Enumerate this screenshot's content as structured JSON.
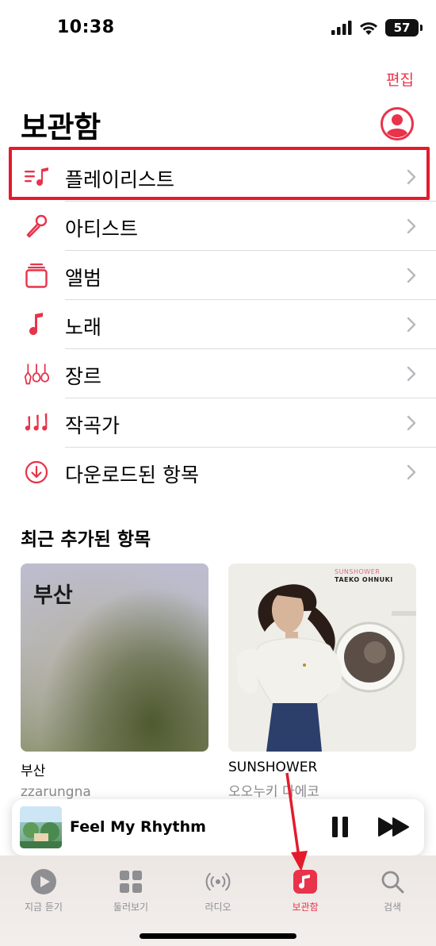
{
  "status": {
    "time": "10:38",
    "battery": "57"
  },
  "header": {
    "edit": "편집",
    "title": "보관함"
  },
  "menu": [
    {
      "label": "플레이리스트",
      "icon": "playlist-icon"
    },
    {
      "label": "아티스트",
      "icon": "microphone-icon"
    },
    {
      "label": "앨범",
      "icon": "album-stack-icon"
    },
    {
      "label": "노래",
      "icon": "music-note-icon"
    },
    {
      "label": "장르",
      "icon": "guitars-icon"
    },
    {
      "label": "작곡가",
      "icon": "composer-notes-icon"
    },
    {
      "label": "다운로드된 항목",
      "icon": "download-circle-icon"
    }
  ],
  "recent": {
    "title": "최근 추가된 항목",
    "albums": [
      {
        "art_text": "부산",
        "title": "부산",
        "subtitle": "zzarungna"
      },
      {
        "art_text_1": "SUNSHOWER",
        "art_text_2": "TAEKO OHNUKI",
        "title": "SUNSHOWER",
        "subtitle": "오오누키 다에코"
      }
    ]
  },
  "mini_player": {
    "title": "Feel My Rhythm"
  },
  "tabs": [
    {
      "label": "지금 듣기",
      "icon": "play-circle-icon"
    },
    {
      "label": "둘러보기",
      "icon": "grid-icon"
    },
    {
      "label": "라디오",
      "icon": "radio-waves-icon"
    },
    {
      "label": "보관함",
      "icon": "library-icon",
      "active": true
    },
    {
      "label": "검색",
      "icon": "search-icon"
    }
  ],
  "colors": {
    "accent": "#e8334a",
    "highlight_box": "#e41b2c"
  }
}
